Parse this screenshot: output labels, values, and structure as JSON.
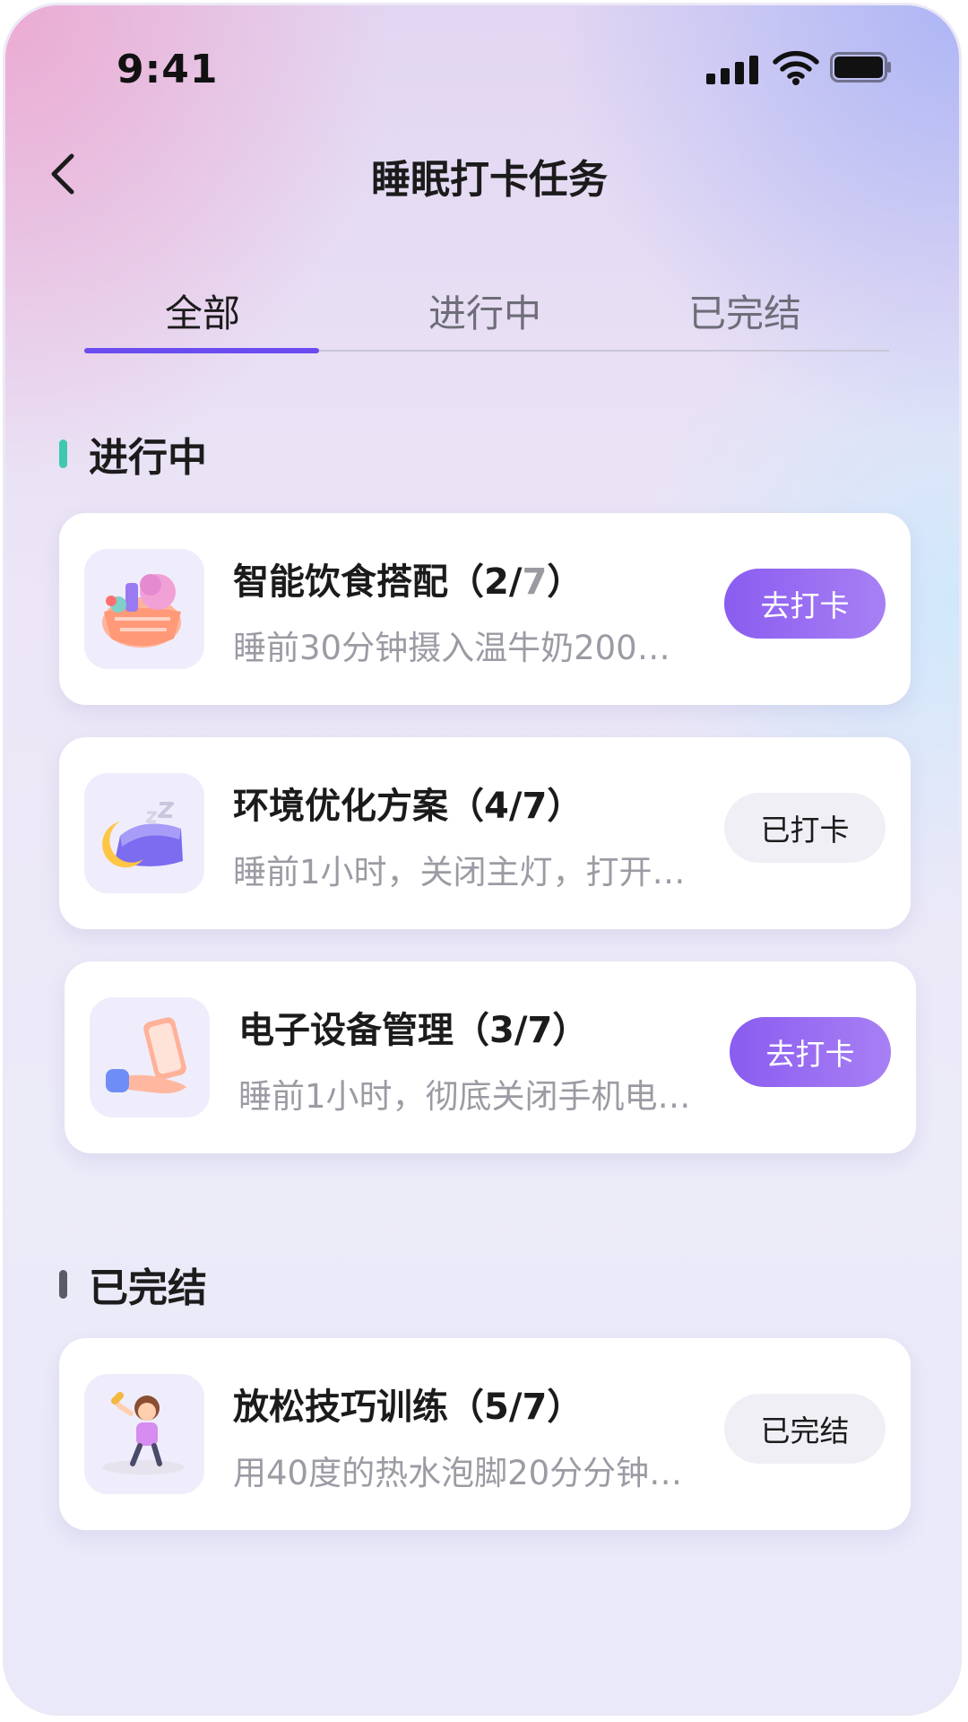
{
  "status_bar": {
    "time": "9:41"
  },
  "header": {
    "title": "睡眠打卡任务"
  },
  "tabs": [
    {
      "label": "全部",
      "active": true
    },
    {
      "label": "进行中",
      "active": false
    },
    {
      "label": "已完结",
      "active": false
    }
  ],
  "sections": [
    {
      "title": "进行中",
      "bar_color": "#3ec8b0"
    },
    {
      "title": "已完结",
      "bar_color": "#5b5b66"
    }
  ],
  "tasks": [
    {
      "name": "智能饮食搭配",
      "progress_prefix": "（2/",
      "progress_total": "7",
      "progress_suffix": "）",
      "done": 2,
      "total": 7,
      "desc": "睡前30分钟摄入温牛奶200…",
      "action": "去打卡",
      "icon": "food-basket-icon"
    },
    {
      "name": "环境优化方案",
      "progress": "（4/7）",
      "done": 4,
      "total": 7,
      "desc": "睡前1小时，关闭主灯，打开…",
      "action": "已打卡",
      "icon": "moon-pillow-icon"
    },
    {
      "name": "电子设备管理",
      "progress": "（3/7）",
      "done": 3,
      "total": 7,
      "desc": "睡前1小时，彻底关闭手机电…",
      "action": "去打卡",
      "icon": "hand-phone-icon"
    },
    {
      "name": "放松技巧训练",
      "progress": "（5/7）",
      "done": 5,
      "total": 7,
      "desc": "用40度的热水泡脚20分分钟…",
      "action": "已完结",
      "icon": "girl-stretch-icon"
    }
  ],
  "colors": {
    "accent": "#6a4cf0",
    "button_primary": "#9066f2",
    "button_secondary": "#f0eff5"
  }
}
